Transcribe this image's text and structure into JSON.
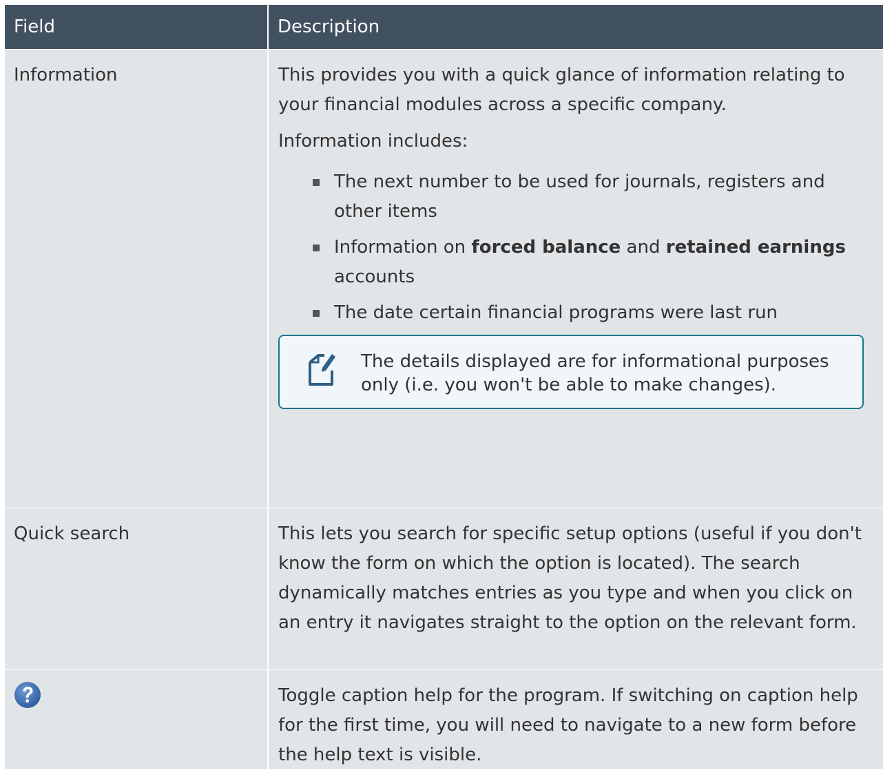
{
  "table": {
    "headers": [
      "Field",
      "Description"
    ],
    "rows": {
      "information": {
        "field": "Information",
        "desc_p1": "This provides you with a quick glance of information relating to your financial modules across a specific company.",
        "desc_p2": "Information includes:",
        "bullets": {
          "b1": "The next number to be used for journals, registers and other items",
          "b2_pre": "Information on ",
          "b2_bold1": "forced balance",
          "b2_mid": " and ",
          "b2_bold2": "retained earnings",
          "b2_post": " accounts",
          "b3": "The date certain financial programs were last run"
        },
        "note": {
          "icon": "note-edit-icon",
          "text": "The details displayed are for informational purposes only (i.e. you won't be able to make changes)."
        }
      },
      "quick_search": {
        "field": "Quick search",
        "desc": "This lets you search for specific setup options (useful if you don't know the form on which the option is located). The search dynamically matches entries as you type and when you click on an entry it navigates straight to the option on the relevant form."
      },
      "help": {
        "field_icon": "question-mark-icon",
        "desc": "Toggle caption help for the program. If switching on caption help for the first time, you will need to navigate to a new form before the help text is visible."
      }
    }
  },
  "colors": {
    "header_bg": "#415160",
    "row_bg": "#e2e5e8",
    "note_border": "#17788d",
    "help_icon": "#3a6fb0"
  }
}
